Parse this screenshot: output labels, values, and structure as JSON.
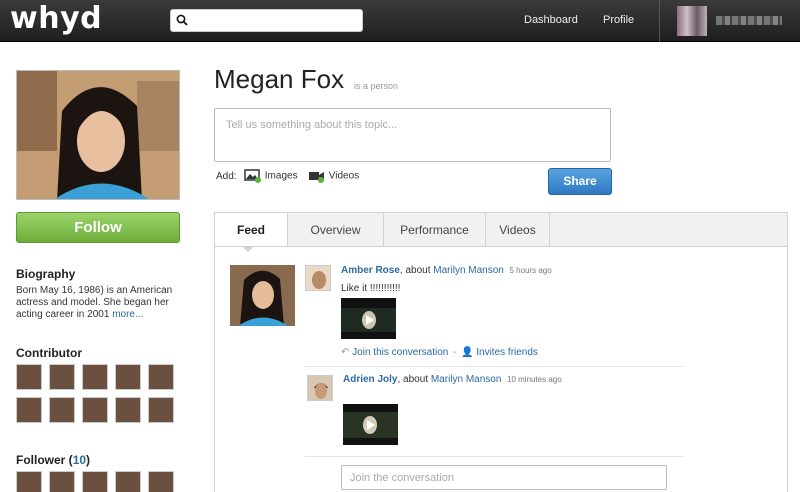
{
  "header": {
    "logo": "whyd",
    "search_placeholder": "",
    "nav": [
      "Dashboard",
      "Profile"
    ]
  },
  "sidebar": {
    "follow_label": "Follow",
    "biography_title": "Biography",
    "biography_text": "Born May 16, 1986) is an American actress and model. She began her acting career in 2001",
    "more_label": "more...",
    "contributor_title": "Contributor",
    "follower_title": "Follower",
    "follower_count": "10"
  },
  "main": {
    "title": "Megan Fox",
    "subtitle": "is a person",
    "post_placeholder": "Tell us something about this topic...",
    "add_label": "Add:",
    "images_label": "Images",
    "videos_label": "Videos",
    "share_label": "Share",
    "tabs": [
      "Feed",
      "Overview",
      "Performance",
      "Videos"
    ],
    "active_tab": "Feed",
    "feed": [
      {
        "author": "Amber Rose",
        "about_label": ", about",
        "topic": "Marilyn Manson",
        "time": "5 hours ago",
        "text": "Like it !!!!!!!!!!!"
      },
      {
        "author": "Adrien Joly",
        "about_label": ", about",
        "topic": "Marilyn Manson",
        "time": "10 minutes ago",
        "text": ""
      }
    ],
    "join_link": "Join this conversation",
    "separator": "-",
    "invite_link": "Invites friends",
    "join_placeholder": "Join the conversation"
  },
  "colors": {
    "accent_link": "#2b6aa3",
    "follow_green": "#7dc04a",
    "share_blue": "#3a86cc",
    "topbar": "#2a2a2a"
  }
}
